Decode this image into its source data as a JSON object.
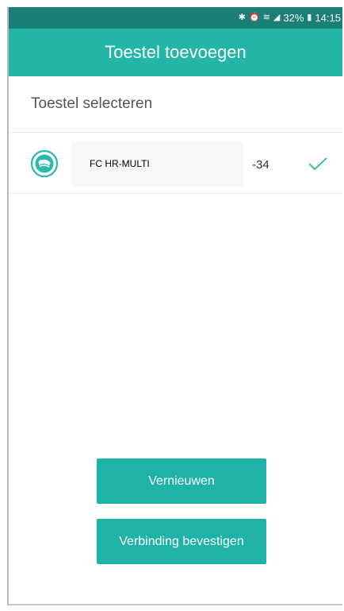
{
  "status_bar": {
    "bluetooth_icon": "bluetooth-icon",
    "alarm_icon": "alarm-icon",
    "wifi_icon": "wifi-icon",
    "signal_icon": "signal-icon",
    "battery_percent": "32%",
    "battery_icon": "battery-icon",
    "time": "14:15"
  },
  "header": {
    "title": "Toestel toevoegen"
  },
  "section": {
    "title": "Toestel selecteren"
  },
  "devices": [
    {
      "name": "FC HR-MULTI",
      "rssi": "-34",
      "icon": "fitness-band-icon",
      "selected": true
    }
  ],
  "buttons": {
    "refresh_label": "Vernieuwen",
    "confirm_label": "Verbinding bevestigen"
  },
  "colors": {
    "status_bar": "#1a7f77",
    "app_bar": "#22b5a8",
    "button": "#1fb3a7",
    "accent": "#2bb8ad"
  }
}
